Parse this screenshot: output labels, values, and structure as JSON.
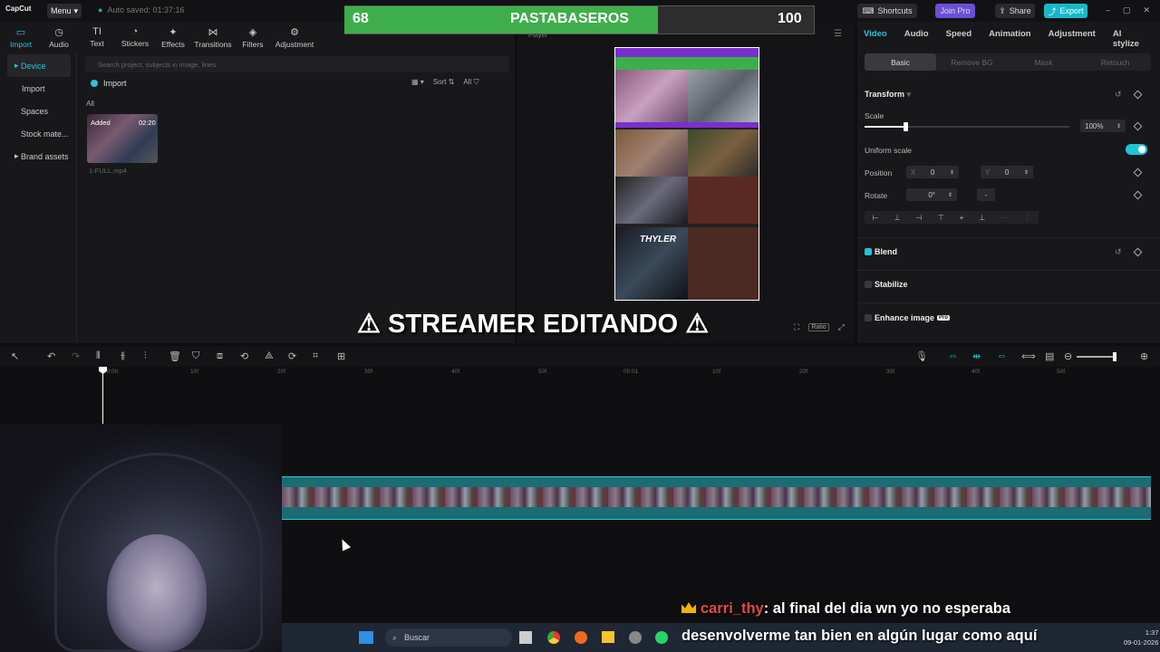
{
  "app": {
    "logo": "CapCut",
    "menu_label": "Menu",
    "autosave": "Auto saved: 01:37:16",
    "shortcuts_label": "Shortcuts",
    "join_pro_label": "Join Pro",
    "share_label": "Share",
    "export_label": "Export"
  },
  "scoreboard": {
    "left_score": "68",
    "title": "PASTABASEROS",
    "right_score": "100",
    "fill_fraction": 0.67
  },
  "left_tabs": [
    {
      "label": "Import",
      "icon": "import-icon"
    },
    {
      "label": "Audio",
      "icon": "audio-icon"
    },
    {
      "label": "Text",
      "icon": "text-icon"
    },
    {
      "label": "Stickers",
      "icon": "stickers-icon"
    },
    {
      "label": "Effects",
      "icon": "effects-icon"
    },
    {
      "label": "Transitions",
      "icon": "transitions-icon"
    },
    {
      "label": "Filters",
      "icon": "filters-icon"
    },
    {
      "label": "Adjustment",
      "icon": "adjustment-icon"
    }
  ],
  "side_nav": [
    "Device",
    "Import",
    "Spaces",
    "Stock mate...",
    "Brand assets"
  ],
  "media": {
    "search_placeholder": "Search project, subjects in image, lines",
    "import_label": "Import",
    "sort_label": "Sort",
    "filter_label": "All",
    "all_label": "All",
    "clip_added": "Added",
    "clip_duration": "02:20",
    "clip_name": "1-FULL.mp4"
  },
  "player": {
    "label": "Player",
    "ratio_label": "Ratio",
    "thyler_label": "THYLER"
  },
  "overlay_banner": "⚠ STREAMER EDITANDO ⚠",
  "right_panel": {
    "tabs": [
      "Video",
      "Audio",
      "Speed",
      "Animation",
      "Adjustment",
      "AI stylize"
    ],
    "sub_tabs": [
      "Basic",
      "Remove BG",
      "Mask",
      "Retouch"
    ],
    "transform_title": "Transform",
    "scale_label": "Scale",
    "scale_value": "100%",
    "scale_slider_fraction": 0.2,
    "uniform_scale_label": "Uniform scale",
    "position_label": "Position",
    "pos_x_label": "X",
    "pos_x_value": "0",
    "pos_y_label": "Y",
    "pos_y_value": "0",
    "rotate_label": "Rotate",
    "rotate_value": "0°",
    "blend_label": "Blend",
    "stabilize_label": "Stabilize",
    "enhance_label": "Enhance image",
    "enhance_badge": "Pro"
  },
  "timeline": {
    "ruler_ticks": [
      "00:00",
      "10f",
      "20f",
      "30f",
      "40f",
      "50f",
      "00:01",
      "10f",
      "20f",
      "30f",
      "40f",
      "50f"
    ]
  },
  "chat": {
    "user": "carri_thy",
    "line1": ": al final del dia wn yo no esperaba",
    "line2": "desenvolverme tan bien en algún lugar como aquí"
  },
  "taskbar": {
    "search_label": "Buscar",
    "time": "1:37",
    "date": "09-01-2026"
  },
  "colors": {
    "accent": "#29c4d3",
    "score_green": "#3eae4c",
    "chat_user": "#e04a4a"
  }
}
